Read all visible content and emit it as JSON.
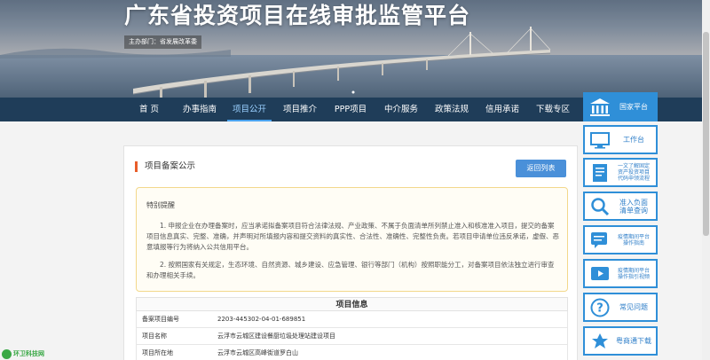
{
  "header": {
    "site_title": "广东省投资项目在线审批监管平台",
    "sponsor": "主办部门：省发展改革委"
  },
  "nav": {
    "items": [
      {
        "label": "首 页"
      },
      {
        "label": "办事指南"
      },
      {
        "label": "项目公开",
        "active": true
      },
      {
        "label": "项目推介"
      },
      {
        "label": "PPP项目"
      },
      {
        "label": "中介服务"
      },
      {
        "label": "政策法规"
      },
      {
        "label": "信用承诺"
      },
      {
        "label": "下载专区"
      }
    ]
  },
  "main": {
    "title": "项目备案公示",
    "back_button": "返回列表",
    "notice": {
      "heading": "特别提醒",
      "p1": "1. 申报企业在办理备案时，应当承诺拟备案项目符合法律法规、产业政策、不属于负面清单所列禁止准入和核准准入项目，提交的备案项目信息真实、完整、准确，并声明对所填报内容和提交资料的真实性、合法性、准确性、完整性负责。若项目申请单位违反承诺，虚假、恶意填报等行为将纳入公共信用平台。",
      "p2": "2. 按照国家有关规定，生态环境、自然资源、城乡建设、应急管理、银行等部门（机构）按照职能分工，对备案项目依法独立进行审查和办理相关手续。"
    },
    "info": {
      "title": "项目信息",
      "rows": [
        {
          "label": "备案项目编号",
          "value": "2203-445302-04-01-689851"
        },
        {
          "label": "项目名称",
          "value": "云浮市云城区建设餐厨垃圾处理站建设项目"
        },
        {
          "label": "项目所在地",
          "value": "云浮市云城区高峰街道罗白山"
        }
      ]
    }
  },
  "side": {
    "items": [
      {
        "label": "国家平台",
        "icon": "government-building-icon"
      },
      {
        "label": "工作台",
        "icon": "monitor-icon"
      },
      {
        "label": "一文了解固定\n资产投资项目\n代码申领流程",
        "icon": "document-icon"
      },
      {
        "label": "准入负面\n清单查询",
        "icon": "search-icon"
      },
      {
        "label": "疫情期间平台\n操作指南",
        "icon": "chat-document-icon"
      },
      {
        "label": "疫情期间平台\n操作指引视频",
        "icon": "video-icon"
      },
      {
        "label": "常见问题",
        "icon": "question-icon"
      },
      {
        "label": "粤商通下载",
        "icon": "app-logo-icon"
      }
    ]
  },
  "watermark": {
    "text": "环卫科技网"
  },
  "colors": {
    "nav_bg": "#1f3d59",
    "accent": "#2f8fd8",
    "title_marker": "#e85d2a",
    "button": "#4a90d9"
  }
}
